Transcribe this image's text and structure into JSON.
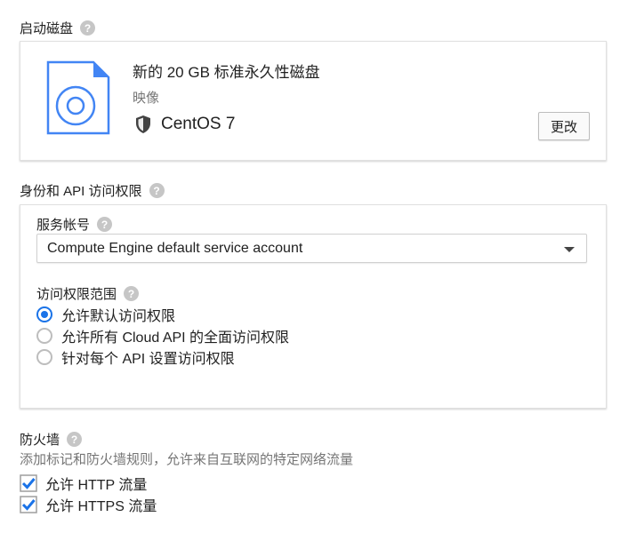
{
  "boot_disk": {
    "title": "启动磁盘",
    "help": "?",
    "disk_name": "新的 20 GB 标准永久性磁盘",
    "image_label": "映像",
    "os_name": "CentOS 7",
    "change_button": "更改"
  },
  "identity": {
    "title": "身份和 API 访问权限",
    "help": "?",
    "service_account_label": "服务帐号",
    "service_account_value": "Compute Engine default service account",
    "access_scope_label": "访问权限范围",
    "scopes": [
      {
        "label": "允许默认访问权限",
        "selected": true
      },
      {
        "label": "允许所有 Cloud API 的全面访问权限",
        "selected": false
      },
      {
        "label": "针对每个 API 设置访问权限",
        "selected": false
      }
    ]
  },
  "firewall": {
    "title": "防火墙",
    "help": "?",
    "description": "添加标记和防火墙规则，允许来自互联网的特定网络流量",
    "options": [
      {
        "label": "允许 HTTP 流量",
        "checked": true
      },
      {
        "label": "允许 HTTPS 流量",
        "checked": true
      }
    ]
  },
  "colors": {
    "accent": "#1a73e8",
    "disk_icon": "#4285f4"
  }
}
